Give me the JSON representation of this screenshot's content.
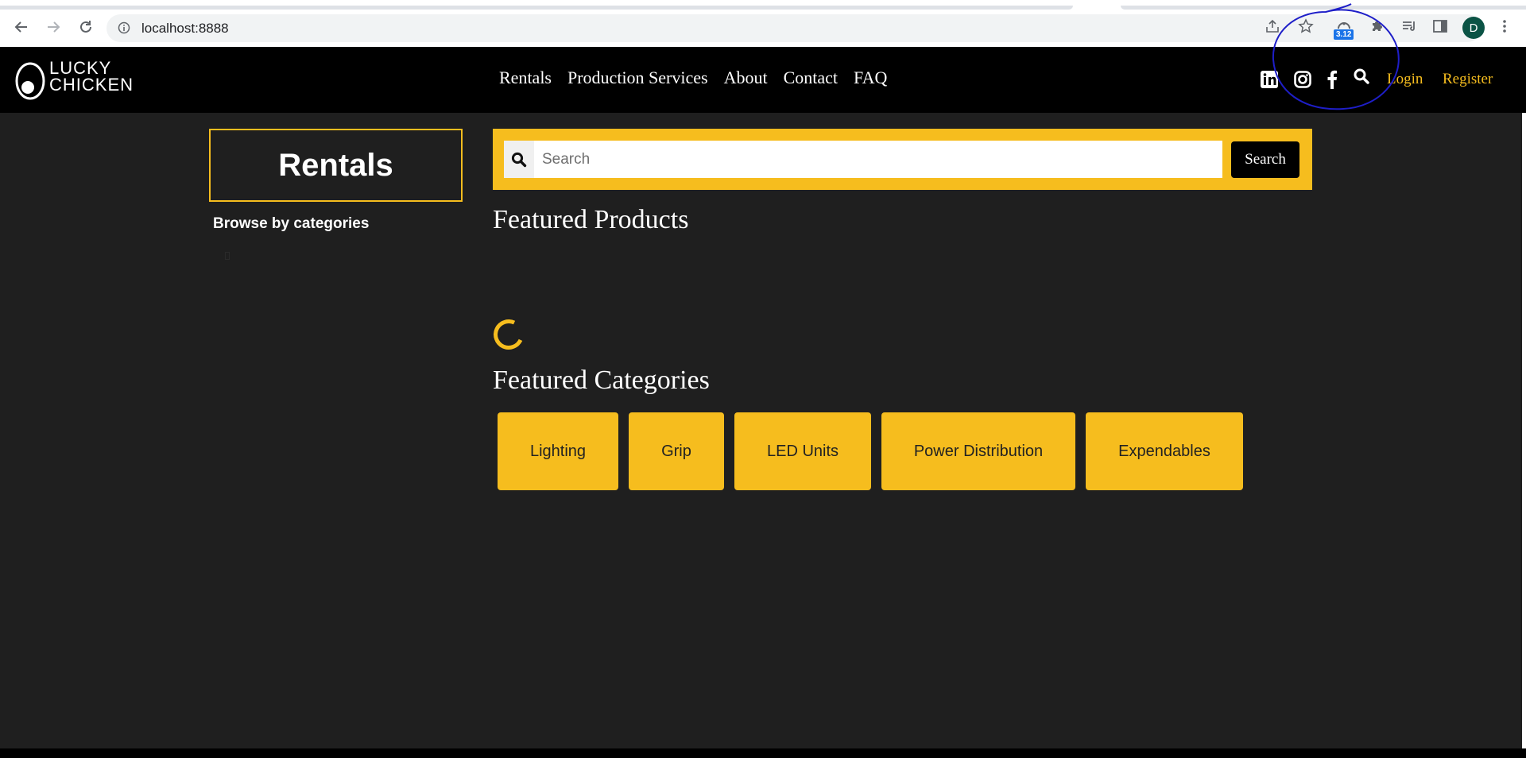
{
  "browser": {
    "url": "localhost:8888",
    "extension_badge": "3.12",
    "profile_initial": "D"
  },
  "site": {
    "logo_line1": "LUCKY",
    "logo_line2": "CHICKEN",
    "nav": [
      "Rentals",
      "Production Services",
      "About",
      "Contact",
      "FAQ"
    ],
    "login": "Login",
    "register": "Register"
  },
  "sidebar": {
    "title": "Rentals",
    "browse_label": "Browse by categories"
  },
  "search": {
    "placeholder": "Search",
    "button_label": "Search"
  },
  "main": {
    "featured_products_title": "Featured Products",
    "featured_categories_title": "Featured Categories",
    "categories": [
      "Lighting",
      "Grip",
      "LED Units",
      "Power Distribution",
      "Expendables"
    ]
  },
  "colors": {
    "accent": "#f6bd1e",
    "background": "#1f1f1f",
    "header": "#000000",
    "annotation": "#1e1ec8"
  }
}
